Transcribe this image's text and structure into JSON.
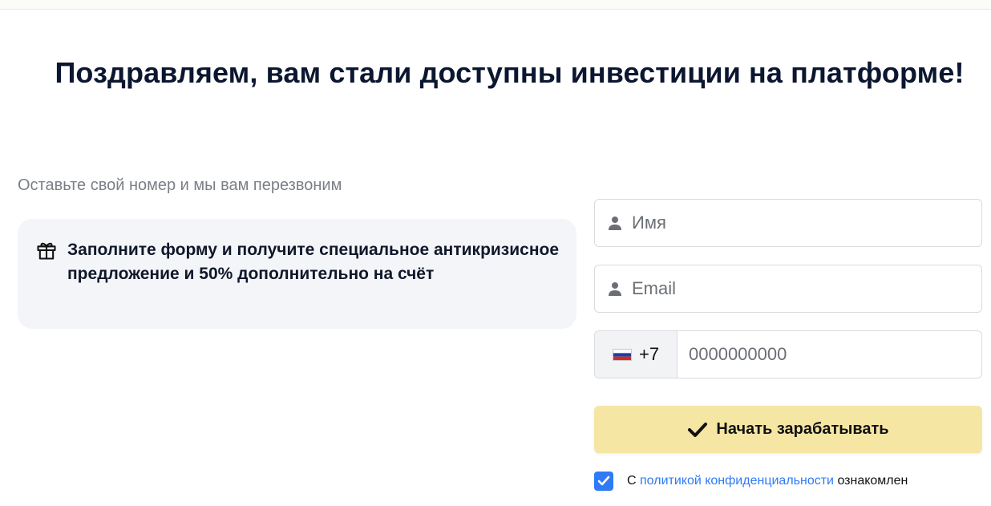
{
  "headline": "Поздравляем, вам стали доступны инвестиции на платформе!",
  "subtitle": "Оставьте свой номер и мы вам перезвоним",
  "promo": {
    "icon": "gift-icon",
    "text": "Заполните форму и получите специальное антикризисное предложение и 50% дополнительно на счёт"
  },
  "form": {
    "name_placeholder": "Имя",
    "email_placeholder": "Email",
    "phone_country_code": "+7",
    "phone_placeholder": "0000000000",
    "submit_label": "Начать зарабатывать",
    "consent": {
      "checked": true,
      "prefix": "С",
      "link_text": "политикой конфиденциальности",
      "suffix": "ознакомлен"
    }
  },
  "colors": {
    "headline": "#0b1630",
    "submit_bg": "#f5e6a4",
    "link": "#2f7af5",
    "checkbox": "#2f7af5",
    "promo_bg": "#f4f5f8"
  }
}
